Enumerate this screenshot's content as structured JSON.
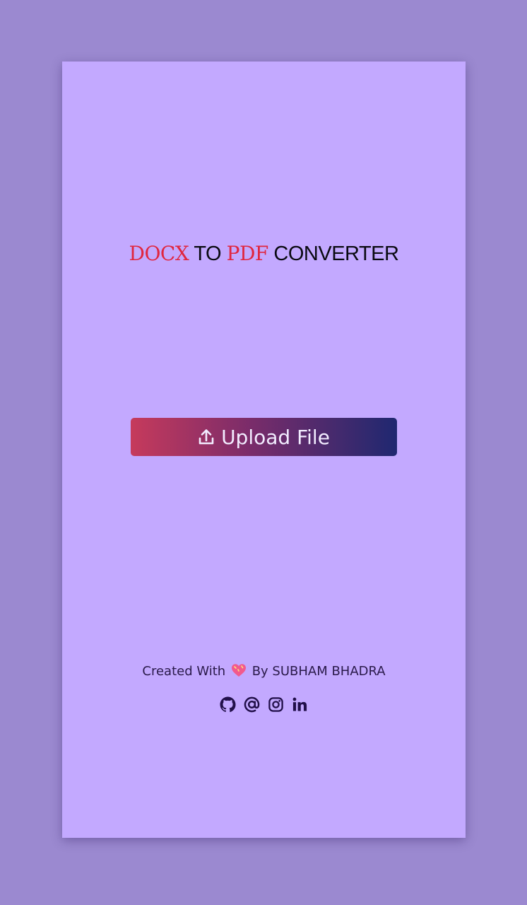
{
  "app": {
    "title_parts": [
      "DOCX",
      " TO ",
      "PDF",
      " CONVERTER"
    ]
  },
  "upload": {
    "label": "Upload File",
    "icon": "upload-icon"
  },
  "footer": {
    "prefix": "Created With",
    "heart_icon": "heart-icon",
    "suffix": "By SUBHAM BHADRA",
    "socials": [
      "github-icon",
      "email-at-icon",
      "instagram-icon",
      "linkedin-icon"
    ]
  },
  "colors": {
    "page_bg": "#9b89d0",
    "card_bg": "#c3a9ff",
    "title_accent": "#e0263f",
    "title_text": "#0a0a12",
    "button_gradient_start": "#c63a5c",
    "button_gradient_end": "#1f2870",
    "icon_color": "#22104a"
  }
}
